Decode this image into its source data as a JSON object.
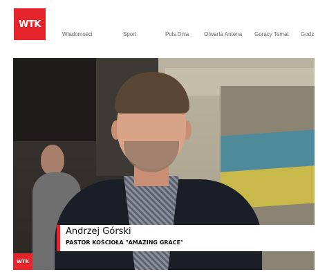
{
  "header": {
    "logo_text": "WTK",
    "nav": [
      {
        "label": "Wiadomości"
      },
      {
        "label": "Sport"
      },
      {
        "label": "Puls Dnia"
      },
      {
        "label": "Otwarta Antena"
      },
      {
        "label": "Gorący Temat"
      },
      {
        "label": "Godz"
      }
    ]
  },
  "video": {
    "caption": {
      "name": "Andrzej Górski",
      "role": "PASTOR KOŚCIOŁA \"AMAZING GRACE\""
    },
    "watermark": "WTK"
  },
  "colors": {
    "brand_red": "#e6242b",
    "nav_text": "#666666"
  }
}
